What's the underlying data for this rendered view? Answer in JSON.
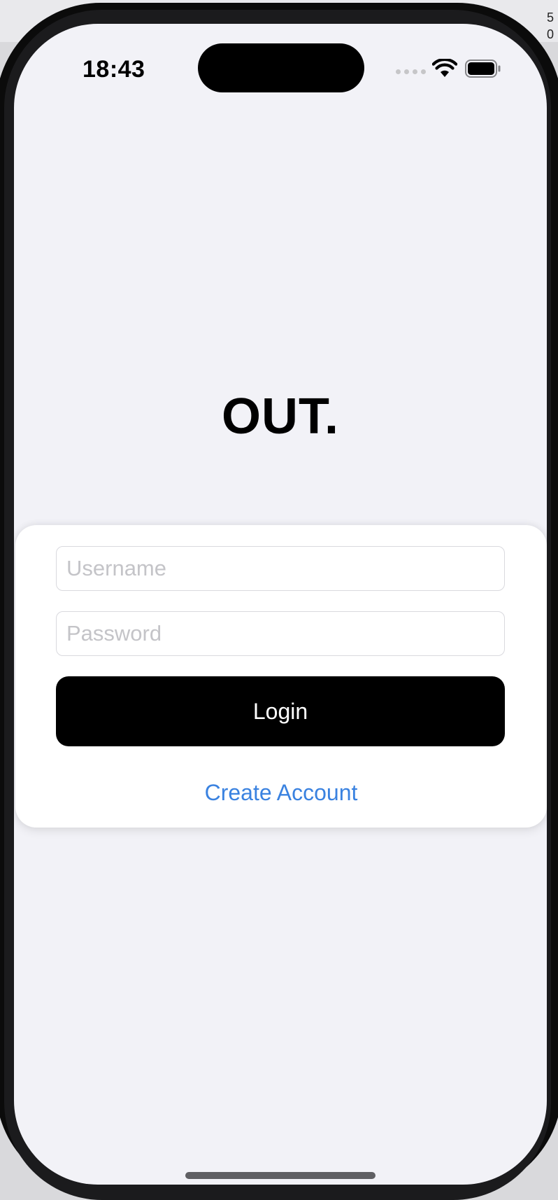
{
  "status_bar": {
    "time": "18:43",
    "signal_icon": "signal-dots-icon",
    "wifi_icon": "wifi-icon",
    "battery_icon": "battery-icon"
  },
  "app": {
    "logo_text": "OUT."
  },
  "login_form": {
    "username_placeholder": "Username",
    "username_value": "",
    "password_placeholder": "Password",
    "password_value": "",
    "login_label": "Login",
    "create_account_label": "Create Account"
  },
  "colors": {
    "screen_background": "#f2f2f7",
    "card_background": "#ffffff",
    "login_button": "#000000",
    "link": "#3a82e0"
  }
}
